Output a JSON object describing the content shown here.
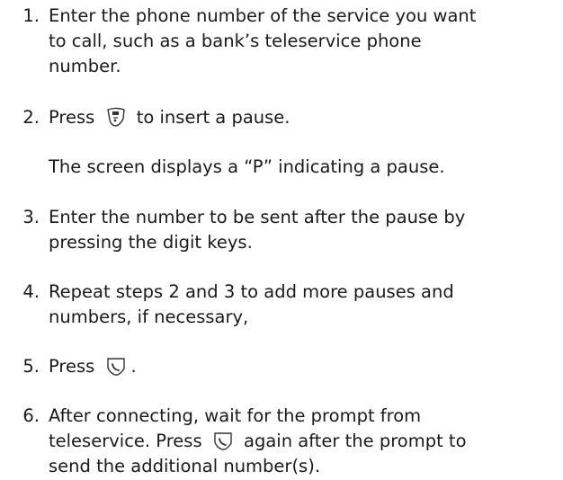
{
  "steps": [
    {
      "number": "1.",
      "lines": [
        "Enter the phone number of the service you want",
        "to call, such as a bank’s teleservice phone",
        "number."
      ]
    },
    {
      "number": "2.",
      "before_icon": "Press",
      "icon": "menu-key-icon",
      "after_icon": "to insert a pause."
    },
    {
      "number": "3.",
      "lines": [
        "Enter the number to be sent after the pause by",
        "pressing the digit keys."
      ]
    },
    {
      "number": "4.",
      "lines": [
        "Repeat steps 2 and 3 to add more pauses and",
        "numbers, if necessary,"
      ]
    },
    {
      "number": "5.",
      "before_icon": "Press",
      "icon": "send-key-icon",
      "after_icon": "."
    },
    {
      "number": "6.",
      "line1": "After connecting, wait for the prompt from",
      "line2_before_icon": "teleservice. Press",
      "icon": "send-key-icon",
      "line2_after_icon": "again after the prompt to",
      "line3": "send the additional number(s)."
    }
  ],
  "note": "The screen displays a “P” indicating a pause.",
  "colors": {
    "text": "#1a1a1a",
    "background": "#ffffff"
  }
}
